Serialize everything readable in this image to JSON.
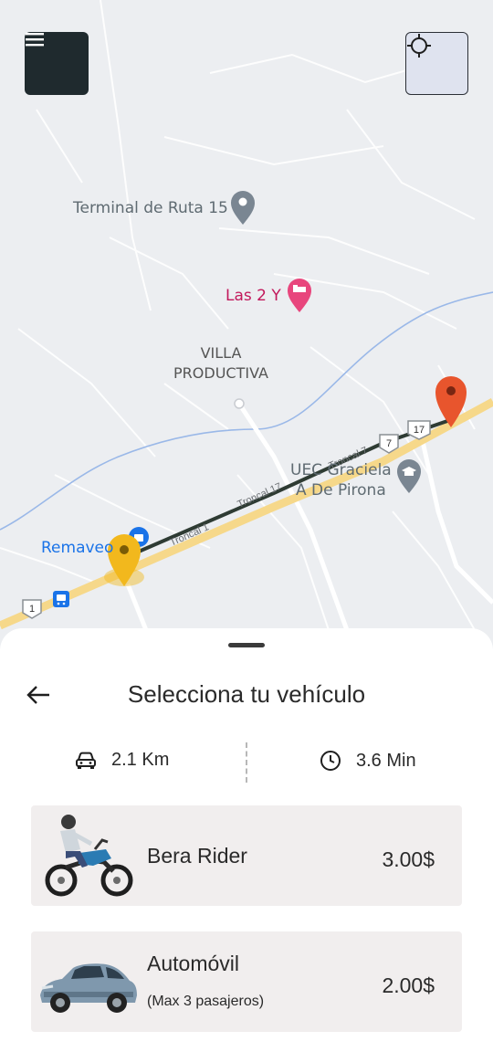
{
  "map": {
    "labels": {
      "terminal": "Terminal de Ruta 15",
      "las2y": "Las 2 Y",
      "villa": "VILLA",
      "productiva": "PRODUCTIVA",
      "uec_line1": "UEC Graciela",
      "uec_line2": "A De Pirona",
      "remaveo": "Remaveo"
    },
    "route_shields": {
      "r7": "7",
      "r17": "17",
      "r1": "1"
    },
    "road_labels": {
      "troncal_a": "Troncal 1",
      "troncal_b": "Troncal 17",
      "troncal_c": "Troncal 7"
    },
    "colors": {
      "route": "#2e3b33",
      "highway": "#f6d88a",
      "origin_pin": "#f2b81d",
      "destination_pin": "#e8552d"
    }
  },
  "sheet": {
    "title": "Selecciona tu vehículo",
    "distance": "2.1 Km",
    "duration": "3.6 Min",
    "vehicles": [
      {
        "name": "Bera Rider",
        "subtitle": "",
        "price": "3.00$",
        "icon": "motorcycle-image"
      },
      {
        "name": "Automóvil",
        "subtitle": "(Max 3 pasajeros)",
        "price": "2.00$",
        "icon": "car-image"
      }
    ]
  }
}
